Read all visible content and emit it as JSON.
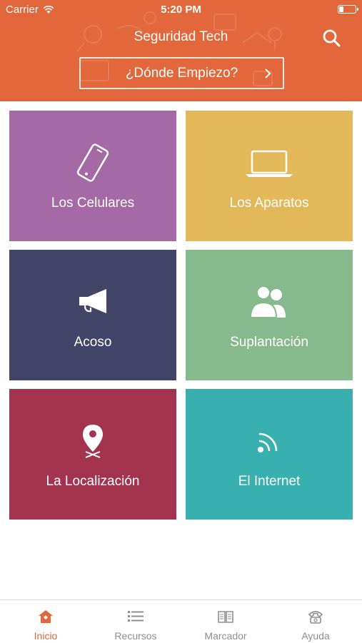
{
  "status_bar": {
    "carrier": "Carrier",
    "time": "5:20 PM"
  },
  "header": {
    "title": "Seguridad Tech",
    "start_label": "¿Dónde Empiezo?"
  },
  "colors": {
    "brand": "#e2673a",
    "tab_inactive": "#8e8e93"
  },
  "tiles": [
    {
      "label": "Los Celulares",
      "icon": "phone-icon",
      "color": "#a56aa5"
    },
    {
      "label": "Los Aparatos",
      "icon": "laptop-icon",
      "color": "#e2b858"
    },
    {
      "label": "Acoso",
      "icon": "megaphone-icon",
      "color": "#424568"
    },
    {
      "label": "Suplantación",
      "icon": "people-icon",
      "color": "#86b98c"
    },
    {
      "label": "La Localización",
      "icon": "location-pin-icon",
      "color": "#a4334f"
    },
    {
      "label": "El Internet",
      "icon": "wifi-signal-icon",
      "color": "#39b0b0"
    }
  ],
  "tabs": [
    {
      "label": "Inicio",
      "icon": "home-icon",
      "active": true
    },
    {
      "label": "Recursos",
      "icon": "list-icon",
      "active": false
    },
    {
      "label": "Marcador",
      "icon": "book-icon",
      "active": false
    },
    {
      "label": "Ayuda",
      "icon": "telephone-icon",
      "active": false
    }
  ]
}
